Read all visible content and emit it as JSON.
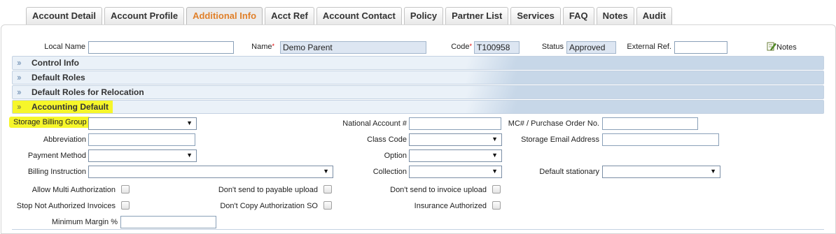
{
  "tabs": [
    {
      "label": "Account Detail"
    },
    {
      "label": "Account Profile"
    },
    {
      "label": "Additional Info",
      "active": true
    },
    {
      "label": "Acct Ref"
    },
    {
      "label": "Account Contact"
    },
    {
      "label": "Policy"
    },
    {
      "label": "Partner List"
    },
    {
      "label": "Services"
    },
    {
      "label": "FAQ"
    },
    {
      "label": "Notes"
    },
    {
      "label": "Audit"
    }
  ],
  "header": {
    "local_name_label": "Local Name",
    "local_name_value": "",
    "name_label": "Name",
    "name_value": "Demo Parent",
    "code_label": "Code",
    "code_value": "T100958",
    "status_label": "Status",
    "status_value": "Approved",
    "external_ref_label": "External Ref.",
    "external_ref_value": "",
    "notes_label": "Notes",
    "notes_icon": "notes-edit-icon",
    "required_marker": "*"
  },
  "sections": [
    {
      "label": "Control Info"
    },
    {
      "label": "Default Roles"
    },
    {
      "label": "Default Roles for Relocation"
    },
    {
      "label": "Accounting Default",
      "highlighted": true
    }
  ],
  "accounting": {
    "storage_billing_group_label": "Storage Billing Group",
    "storage_billing_group_value": "",
    "abbreviation_label": "Abbreviation",
    "abbreviation_value": "",
    "payment_method_label": "Payment Method",
    "payment_method_value": "",
    "billing_instruction_label": "Billing Instruction",
    "billing_instruction_value": "",
    "national_account_label": "National Account #",
    "national_account_value": "",
    "class_code_label": "Class Code",
    "class_code_value": "",
    "option_label": "Option",
    "option_value": "",
    "collection_label": "Collection",
    "collection_value": "",
    "mc_po_label": "MC# / Purchase Order No.",
    "mc_po_value": "",
    "storage_email_label": "Storage Email Address",
    "storage_email_value": "",
    "default_stationary_label": "Default stationary",
    "default_stationary_value": "",
    "allow_multi_auth_label": "Allow Multi Authorization",
    "allow_multi_auth_checked": false,
    "stop_not_auth_label": "Stop Not Authorized Invoices",
    "stop_not_auth_checked": false,
    "dont_send_payable_label": "Don't send to payable upload",
    "dont_send_payable_checked": false,
    "dont_copy_auth_label": "Don't Copy Authorization SO",
    "dont_copy_auth_checked": false,
    "dont_send_invoice_label": "Don't send to invoice upload",
    "dont_send_invoice_checked": false,
    "insurance_auth_label": "Insurance Authorized",
    "insurance_auth_checked": false,
    "minimum_margin_label": "Minimum Margin %",
    "minimum_margin_value": ""
  },
  "colors": {
    "active_tab_text": "#e0802a",
    "section_bar": "#eaf1f8",
    "highlight": "#f6f62a",
    "required": "#dd0000"
  }
}
